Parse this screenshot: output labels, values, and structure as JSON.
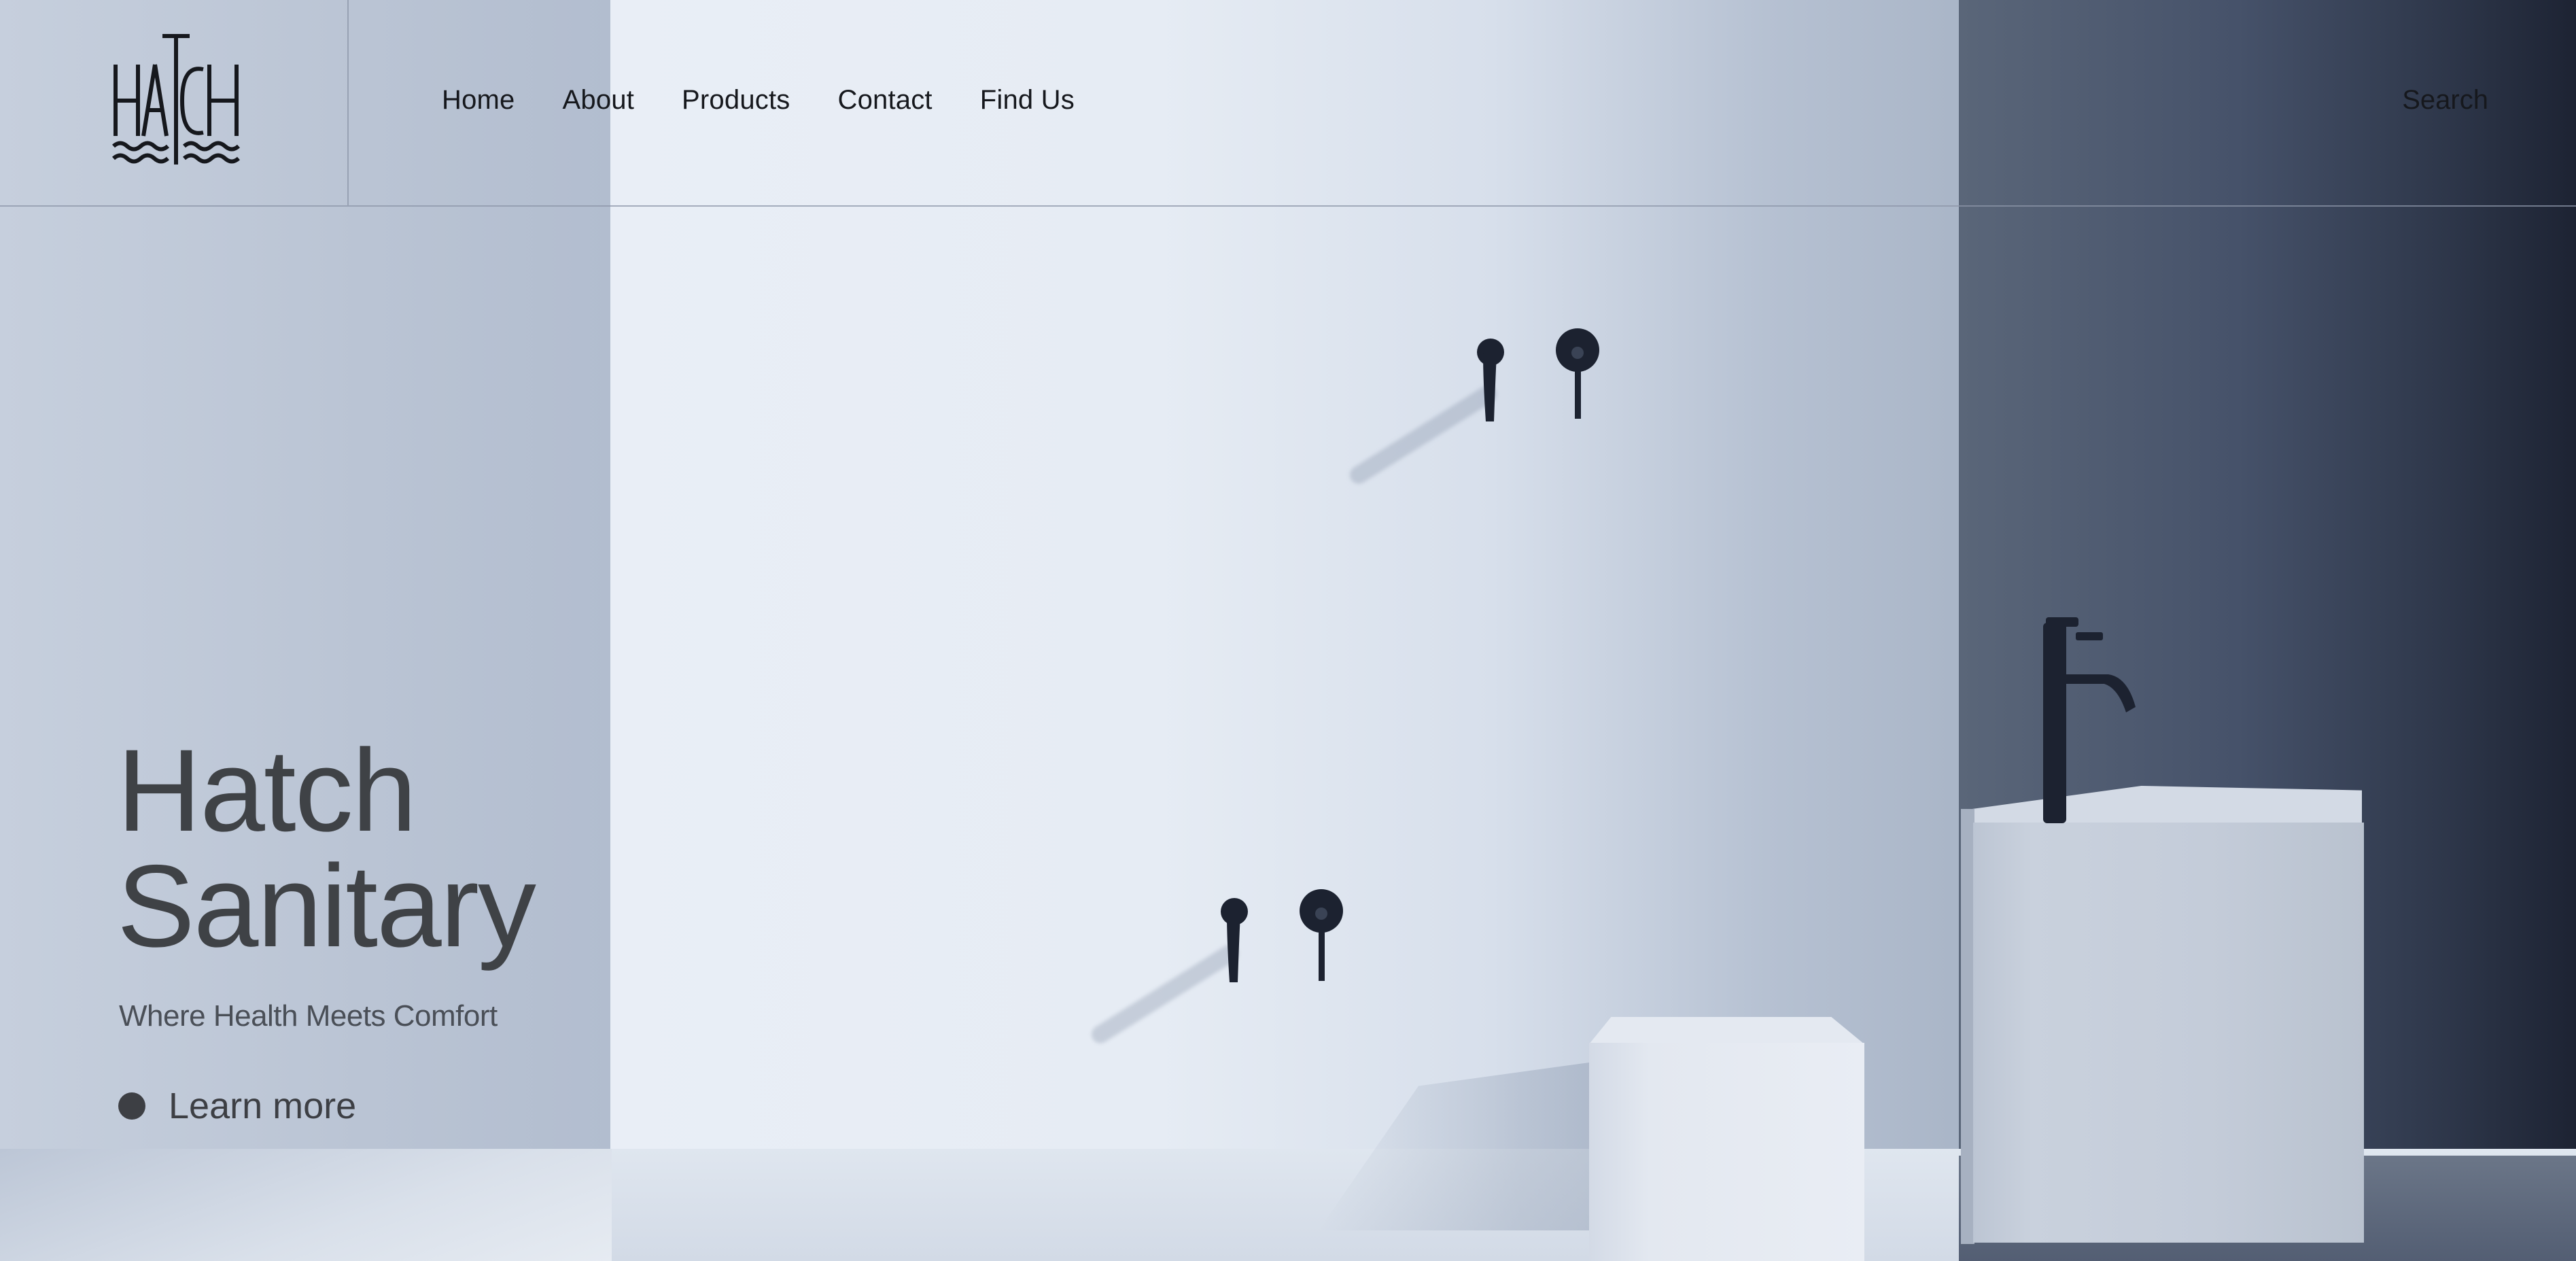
{
  "brand": {
    "logo_text": "HATCH"
  },
  "nav": {
    "items": [
      {
        "label": "Home"
      },
      {
        "label": "About"
      },
      {
        "label": "Products"
      },
      {
        "label": "Contact"
      },
      {
        "label": "Find Us"
      }
    ],
    "search_label": "Search"
  },
  "hero": {
    "title_line1": "Hatch",
    "title_line2": "Sanitary",
    "subtitle": "Where Health Meets Comfort",
    "cta_label": "Learn more"
  },
  "colors": {
    "text_dark": "#16181d",
    "hero_text": "#3f4246",
    "faucet": "#1c2230"
  },
  "icons": {
    "logo": "hatch-wave-logo",
    "cta": "dot-icon",
    "fixtures": [
      "wall-spout-icon",
      "wall-handle-icon",
      "basin-mixer-icon"
    ]
  }
}
